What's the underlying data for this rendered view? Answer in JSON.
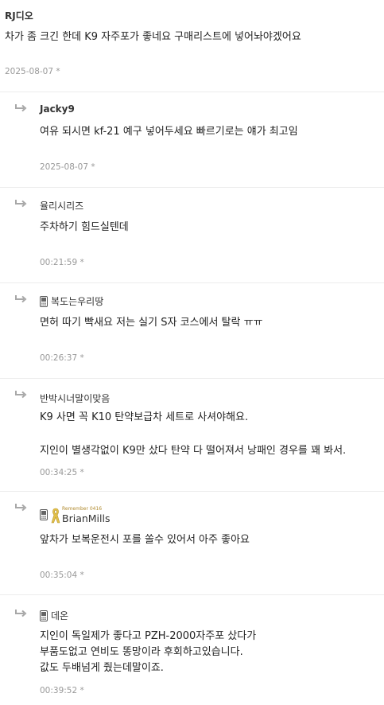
{
  "top_comment": {
    "nickname": "RJ디오",
    "body": "차가 좀 크긴 한데 K9 자주포가 좋네요 구매리스트에 넣어놔야겠어요",
    "meta": "2025-08-07 *"
  },
  "replies": [
    {
      "nickname": "Jacky9",
      "body": [
        "여유 되시면 kf-21 예구 넣어두세요 빠르기로는 얘가 최고임"
      ],
      "meta": "2025-08-07 *"
    },
    {
      "nickname": "율리시리즈",
      "body": [
        "주차하기 힘드실텐데"
      ],
      "meta": "00:21:59 *"
    },
    {
      "nickname": "복도는우리땅",
      "body": [
        "면허 따기 빡새요 저는 실기 S자 코스에서 탈락 ㅠㅠ"
      ],
      "meta": "00:26:37 *"
    },
    {
      "nickname": "반박시너말이맞음",
      "body": [
        "K9 사면 꼭 K10 탄약보급차 세트로 사셔야해요.",
        "",
        "지인이 별생각없이 K9만 샀다 탄약 다 떨어져서 낭패인 경우를 꽤 봐서."
      ],
      "meta": "00:34:25 *"
    },
    {
      "nickname": "BrianMills",
      "remember_badge": "Remember 0416",
      "body": [
        "앞차가 보복운전시 포를 쏠수 있어서 아주 좋아요"
      ],
      "meta": "00:35:04 *"
    },
    {
      "nickname": "데온",
      "body": [
        "지인이 독일제가 좋다고 PZH-2000자주포 샀다가",
        "부품도없고 연비도 똥망이라 후회하고있습니다.",
        "값도 두배넘게 줬는데말이죠."
      ],
      "meta": "00:39:52 *"
    }
  ],
  "colors": {
    "meta": "#999999",
    "divider": "#ececec",
    "arrow": "#a8a8a8",
    "ribbon": "#e3c14a"
  },
  "icons": {
    "reply": "reply-arrow-icon",
    "mobile": "mobile-phone-icon",
    "ribbon": "yellow-ribbon-icon"
  }
}
